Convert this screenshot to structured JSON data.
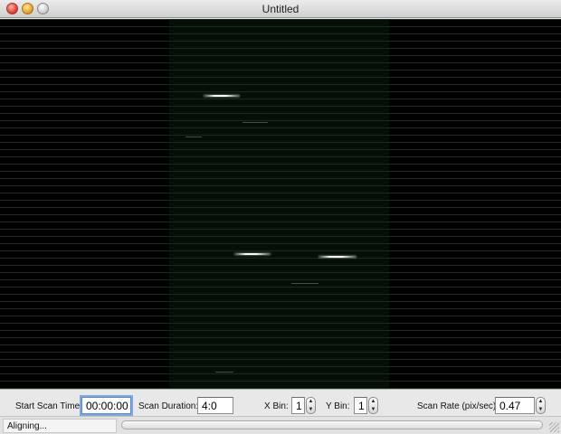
{
  "window": {
    "title": "Untitled"
  },
  "controls": {
    "start_scan_time": {
      "label": "Start Scan Time:",
      "value": "00:00:00"
    },
    "scan_duration": {
      "label": "Scan Duration:",
      "value": "4:0"
    },
    "x_bin": {
      "label": "X Bin:",
      "value": "1"
    },
    "y_bin": {
      "label": "Y Bin:",
      "value": "1"
    },
    "scan_rate": {
      "label": "Scan Rate (pix/sec):",
      "value": "0.47"
    }
  },
  "status": {
    "text": "Aligning...",
    "progress": 0
  },
  "colors": {
    "background": "#000000",
    "scanline": "#1a3a20",
    "focus_ring": "#7fa8de"
  }
}
